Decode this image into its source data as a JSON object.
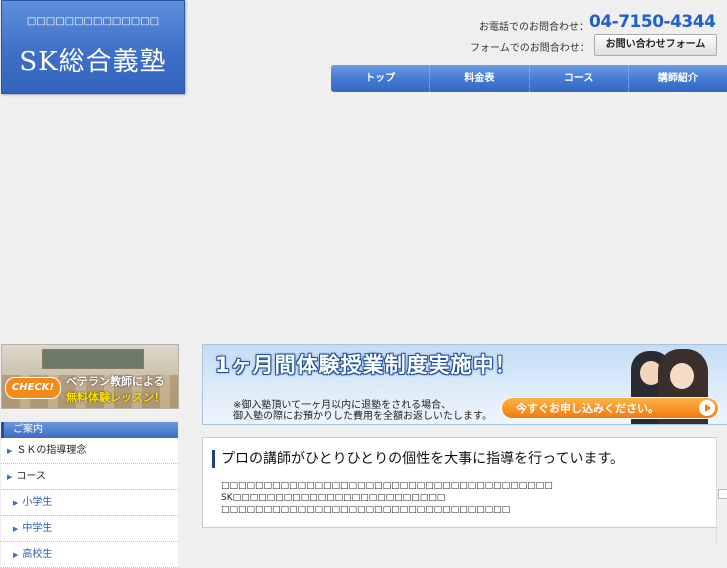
{
  "logo": {
    "tagline": "□□□□□□□□□□□□□□",
    "name": "SK総合義塾"
  },
  "contact": {
    "phone_label": "お電話でのお問合わせ：",
    "phone_number": "04-7150-4344",
    "form_label": "フォームでのお問合わせ：",
    "form_button": "お問い合わせフォーム"
  },
  "nav": {
    "items": [
      {
        "label": "トップ"
      },
      {
        "label": "料金表"
      },
      {
        "label": "コース"
      },
      {
        "label": "講師紹介"
      }
    ]
  },
  "check_banner": {
    "badge": "CHECK!",
    "line1": "ベテラン教師による",
    "line2": "無料体験レッスン！"
  },
  "sidebar": {
    "header": "ご案内",
    "items": [
      {
        "label": "ＳＫの指導理念"
      },
      {
        "label": "コース"
      },
      {
        "label": "小学生"
      },
      {
        "label": "中学生"
      },
      {
        "label": "高校生"
      }
    ]
  },
  "trial_banner": {
    "headline": "1ヶ月間体験授業制度実施中！",
    "note1": "※御入塾頂いて一ヶ月以内に退塾をされる場合、",
    "note2": "御入塾の際にお預かりした費用を全額お返しいたします。",
    "apply": "今すぐお申し込みください。"
  },
  "content": {
    "heading": "プロの講師がひとりひとりの個性を大事に指導を行っています。",
    "line1": "□□□□□□□□□□□□□□□□□□□□□□□□□□□□□□□□□□□□□□□",
    "line2": "SK□□□□□□□□□□□□□□□□□□□□□□□□□",
    "line3": "□□□□□□□□□□□□□□□□□□□□□□□□□□□□□□□□□□"
  }
}
